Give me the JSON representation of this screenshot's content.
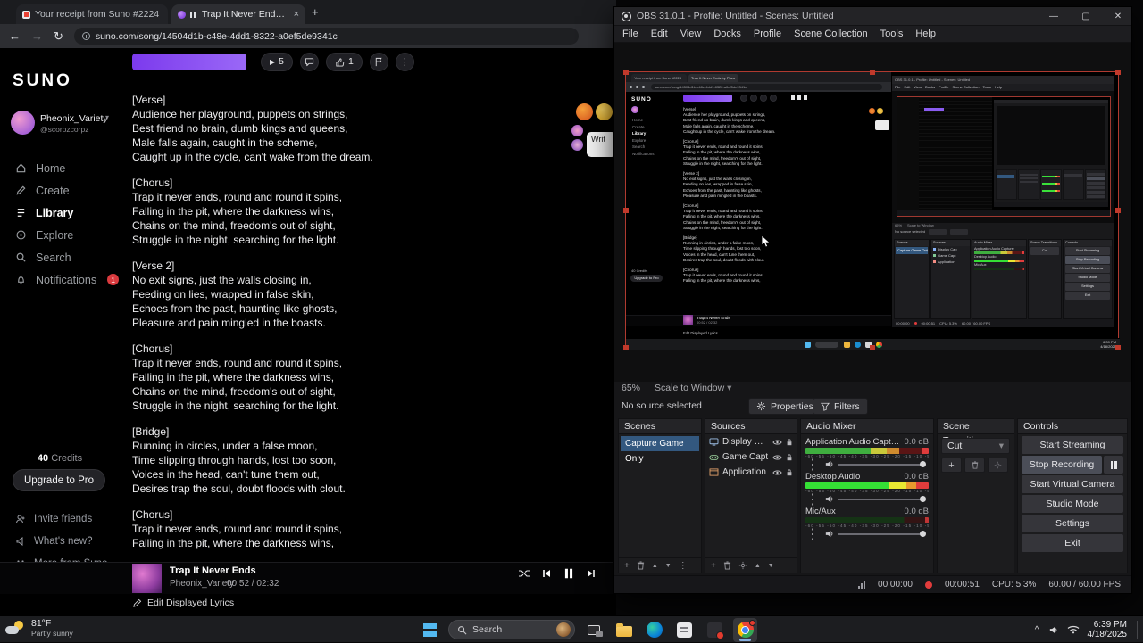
{
  "browser": {
    "tabs": [
      {
        "title": "Your receipt from Suno #2224"
      },
      {
        "title": "Trap It Never Ends by Pheo"
      }
    ],
    "url": "suno.com/song/14504d1b-c48e-4dd1-8322-a0ef5de9341c",
    "suno": {
      "logo": "SUNO",
      "user": {
        "name": "Pheonix_Variety",
        "handle": "@scorpzcorpz"
      },
      "nav": [
        {
          "label": "Home"
        },
        {
          "label": "Create"
        },
        {
          "label": "Library"
        },
        {
          "label": "Explore"
        },
        {
          "label": "Search"
        },
        {
          "label": "Notifications",
          "badge": "1"
        }
      ],
      "credits_value": "40",
      "credits_label": "Credits",
      "upgrade_button": "Upgrade to Pro",
      "footer_links": [
        {
          "label": "Invite friends"
        },
        {
          "label": "What's new?"
        },
        {
          "label": "More from Suno"
        }
      ],
      "song_actions": {
        "plays": "5",
        "likes": "1"
      },
      "overlay_card": "Writ",
      "lyrics": [
        {
          "tag": "[Verse]",
          "lines": [
            "Audience her playground, puppets on strings,",
            "Best friend no brain, dumb kings and queens,",
            "Male falls again, caught in the scheme,",
            "Caught up in the cycle, can't wake from the dream."
          ]
        },
        {
          "tag": "[Chorus]",
          "lines": [
            "Trap it never ends, round and round it spins,",
            "Falling in the pit, where the darkness wins,",
            "Chains on the mind, freedom's out of sight,",
            "Struggle in the night, searching for the light."
          ]
        },
        {
          "tag": "[Verse 2]",
          "lines": [
            "No exit signs, just the walls closing in,",
            "Feeding on lies, wrapped in false skin,",
            "Echoes from the past, haunting like ghosts,",
            "Pleasure and pain mingled in the boasts."
          ]
        },
        {
          "tag": "[Chorus]",
          "lines": [
            "Trap it never ends, round and round it spins,",
            "Falling in the pit, where the darkness wins,",
            "Chains on the mind, freedom's out of sight,",
            "Struggle in the night, searching for the light."
          ]
        },
        {
          "tag": "[Bridge]",
          "lines": [
            "Running in circles, under a false moon,",
            "Time slipping through hands, lost too soon,",
            "Voices in the head, can't tune them out,",
            "Desires trap the soul, doubt floods with clout."
          ]
        },
        {
          "tag": "[Chorus]",
          "lines": [
            "Trap it never ends, round and round it spins,",
            "Falling in the pit, where the darkness wins,"
          ]
        }
      ],
      "player": {
        "title": "Trap It Never Ends",
        "artist": "Pheonix_Variety",
        "time": "00:52 / 02:32"
      },
      "edit_lyrics_label": "Edit Displayed Lyrics"
    }
  },
  "obs": {
    "window_title": "OBS 31.0.1 - Profile: Untitled - Scenes: Untitled",
    "menu": [
      "File",
      "Edit",
      "View",
      "Docks",
      "Profile",
      "Scene Collection",
      "Tools",
      "Help"
    ],
    "zoom_percent": "65%",
    "scale_mode": "Scale to Window",
    "no_source": "No source selected",
    "properties_button": "Properties",
    "filters_button": "Filters",
    "scenes_panel": {
      "title": "Scenes",
      "items": [
        {
          "label": "Capture Game Only"
        }
      ]
    },
    "sources_panel": {
      "title": "Sources",
      "items": [
        {
          "label": "Display Cap"
        },
        {
          "label": "Game Capt"
        },
        {
          "label": "Application"
        }
      ]
    },
    "mixer_panel": {
      "title": "Audio Mixer",
      "channels": [
        {
          "name": "Application Audio Capture",
          "level": "0.0 dB"
        },
        {
          "name": "Desktop Audio",
          "level": "0.0 dB"
        },
        {
          "name": "Mic/Aux",
          "level": "0.0 dB"
        }
      ],
      "tick_scale": "-60 -55 -50 -45 -40 -35 -30 -25 -20 -15 -10 -5 0"
    },
    "transitions_panel": {
      "title": "Scene Transitions",
      "selected": "Cut"
    },
    "controls_panel": {
      "title": "Controls",
      "buttons": [
        "Start Streaming",
        "Stop Recording",
        "Start Virtual Camera",
        "Studio Mode",
        "Settings",
        "Exit"
      ]
    },
    "statusbar": {
      "stream_time": "00:00:00",
      "rec_time": "00:00:51",
      "cpu": "CPU: 5.3%",
      "fps": "60.00 / 60.00 FPS"
    }
  },
  "taskbar": {
    "weather_temp": "81°F",
    "weather_cond": "Partly sunny",
    "search_label": "Search",
    "clock_time": "6:39 PM",
    "clock_date": "4/18/2025"
  },
  "icons": {
    "search": "magnifier",
    "settings": "gear",
    "filters": "funnel",
    "record": "red-dot",
    "pause": "double-bar",
    "play": "triangle",
    "eye": "eye",
    "lock": "padlock",
    "trash": "trash-can"
  }
}
